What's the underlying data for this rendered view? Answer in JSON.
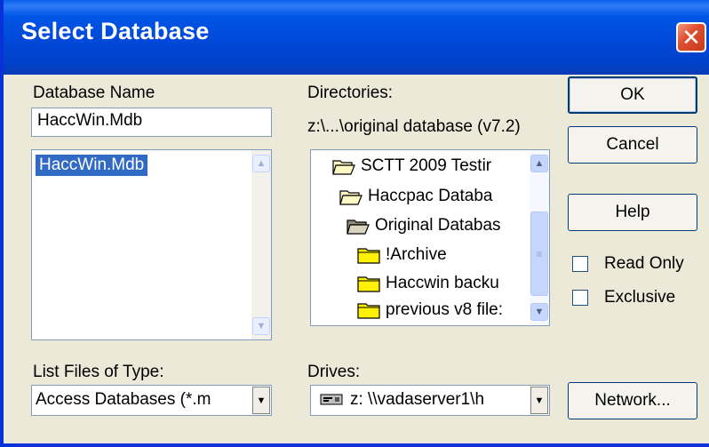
{
  "dialog": {
    "title": "Select Database"
  },
  "database_name": {
    "label": "Database Name",
    "value": "HaccWin.Mdb",
    "files": [
      "HaccWin.Mdb"
    ]
  },
  "directories": {
    "label": "Directories:",
    "current_path": "z:\\...\\original database (v7.2)",
    "items": [
      {
        "label": "SCTT 2009 Testir",
        "icon": "open-folder-icon"
      },
      {
        "label": "Haccpac Databa",
        "icon": "open-folder-icon"
      },
      {
        "label": "Original Databas",
        "icon": "open-folder-selected-icon"
      },
      {
        "label": "!Archive",
        "icon": "folder-icon"
      },
      {
        "label": "Haccwin backu",
        "icon": "folder-icon"
      },
      {
        "label": "previous v8 file:",
        "icon": "folder-icon"
      }
    ]
  },
  "buttons": {
    "ok": "OK",
    "cancel": "Cancel",
    "help": "Help",
    "network": "Network..."
  },
  "options": {
    "read_only": {
      "label": "Read Only",
      "checked": false
    },
    "exclusive": {
      "label": "Exclusive",
      "checked": false
    }
  },
  "file_type": {
    "label": "List Files of Type:",
    "value": "Access Databases (*.m"
  },
  "drives": {
    "label": "Drives:",
    "value": "z: \\\\vadaserver1\\h",
    "icon": "network-drive-icon"
  },
  "colors": {
    "titlebar": "#0054E3",
    "selection": "#316AC5",
    "face": "#ECE9D8",
    "close": "#E0502F"
  }
}
